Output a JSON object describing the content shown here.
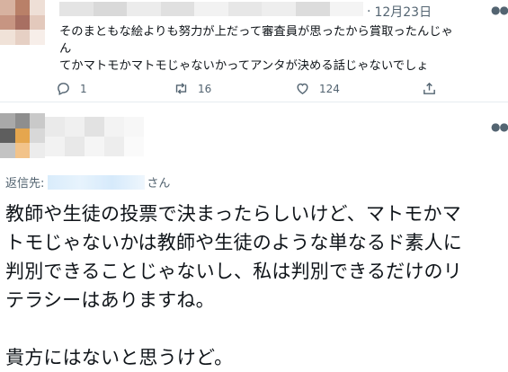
{
  "reply_tweet": {
    "date": "12月23日",
    "lines": [
      "そのまともな絵よりも努力が上だって審査員が思ったから賞取ったんじゃ",
      "ん",
      "てかマトモかマトモじゃないかってアンタが決める話じゃないでしょ"
    ],
    "counts": {
      "replies": "1",
      "retweets": "16",
      "likes": "124"
    },
    "icons": {
      "reply": "speech-bubble-icon",
      "retweet": "retweet-icon",
      "like": "heart-icon",
      "share": "share-icon",
      "more": "more-icon"
    }
  },
  "main_tweet": {
    "replying_label": "返信先:",
    "replying_suffix": "さん",
    "body_lines": [
      "教師や生徒の投票で決まったらしいけど、マトモかマ",
      "トモじゃないかは教師や生徒のような単なるド素人に",
      "判別できることじゃないし、私は判別できるだけのリ",
      "テラシーはありますね。",
      "",
      "貴方にはないと思うけど。"
    ],
    "icons": {
      "more": "more-icon"
    }
  },
  "colors": {
    "text": "#0f1419",
    "secondary": "#536471",
    "border": "#e6ecf0",
    "mention_blur": "#d9ecfb"
  }
}
